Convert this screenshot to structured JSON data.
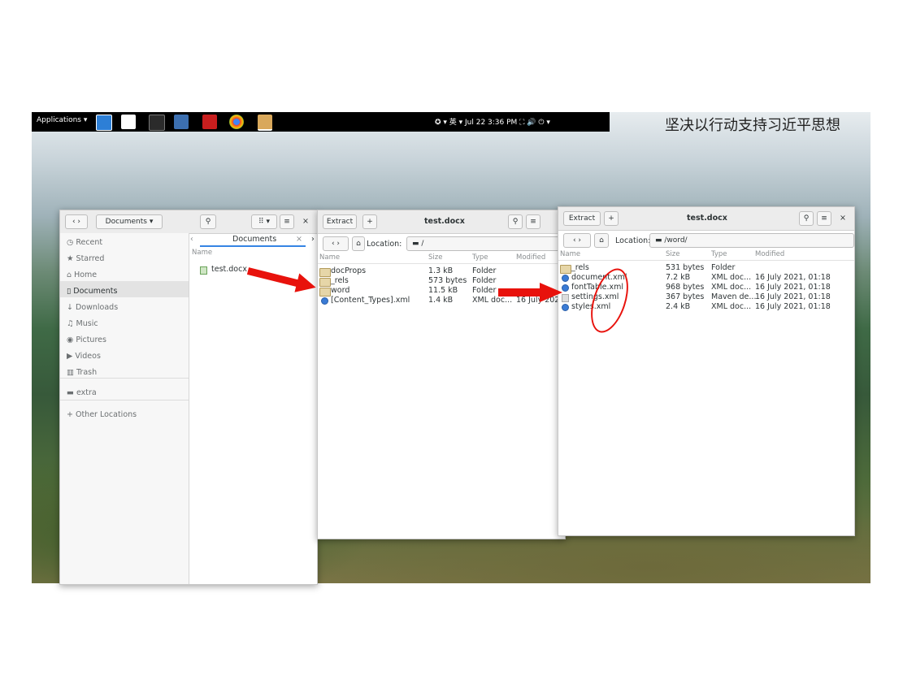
{
  "topbar": {
    "applications": "Applications ▾",
    "status": "✪ ▾    英 ▾    Jul 22  3:36 PM    ⛶  🔊  ⏻ ▾"
  },
  "slogan": "坚决以行动支持习近平思想",
  "file_manager": {
    "path_button": "Documents",
    "tab_label": "Documents",
    "col_name": "Name",
    "files": [
      "test.docx"
    ],
    "sidebar": [
      "Recent",
      "Starred",
      "Home",
      "Documents",
      "Downloads",
      "Music",
      "Pictures",
      "Videos",
      "Trash",
      "extra",
      "+ Other Locations"
    ],
    "sidebar_icons": [
      "clock-icon",
      "star-icon",
      "home-icon",
      "document-icon",
      "download-icon",
      "music-icon",
      "camera-icon",
      "video-icon",
      "trash-icon",
      "folder-icon",
      ""
    ]
  },
  "archive1": {
    "extract": "Extract",
    "add": "+",
    "title": "test.docx",
    "location_label": "Location:",
    "location": "/",
    "columns": [
      "Name",
      "Size",
      "Type",
      "Modified"
    ],
    "rows": [
      {
        "name": "docProps",
        "size": "1.3 kB",
        "type": "Folder",
        "modified": "",
        "icon": "folder"
      },
      {
        "name": "_rels",
        "size": "573 bytes",
        "type": "Folder",
        "modified": "",
        "icon": "folder"
      },
      {
        "name": "word",
        "size": "11.5 kB",
        "type": "Folder",
        "modified": "",
        "icon": "folder"
      },
      {
        "name": "[Content_Types].xml",
        "size": "1.4 kB",
        "type": "XML doc...",
        "modified": "16 July 202...",
        "icon": "xml"
      }
    ]
  },
  "archive2": {
    "extract": "Extract",
    "add": "+",
    "title": "test.docx",
    "location_label": "Location:",
    "location": "/word/",
    "columns": [
      "Name",
      "Size",
      "Type",
      "Modified"
    ],
    "rows": [
      {
        "name": "_rels",
        "size": "531 bytes",
        "type": "Folder",
        "modified": "",
        "icon": "folder"
      },
      {
        "name": "document.xml",
        "size": "7.2 kB",
        "type": "XML doc...",
        "modified": "16 July 2021, 01:18",
        "icon": "xml"
      },
      {
        "name": "fontTable.xml",
        "size": "968 bytes",
        "type": "XML doc...",
        "modified": "16 July 2021, 01:18",
        "icon": "xml"
      },
      {
        "name": "settings.xml",
        "size": "367 bytes",
        "type": "Maven de...",
        "modified": "16 July 2021, 01:18",
        "icon": "generic"
      },
      {
        "name": "styles.xml",
        "size": "2.4 kB",
        "type": "XML doc...",
        "modified": "16 July 2021, 01:18",
        "icon": "xml"
      }
    ]
  },
  "colors": {
    "annotation": "#e8120c",
    "panel": "#000000"
  }
}
